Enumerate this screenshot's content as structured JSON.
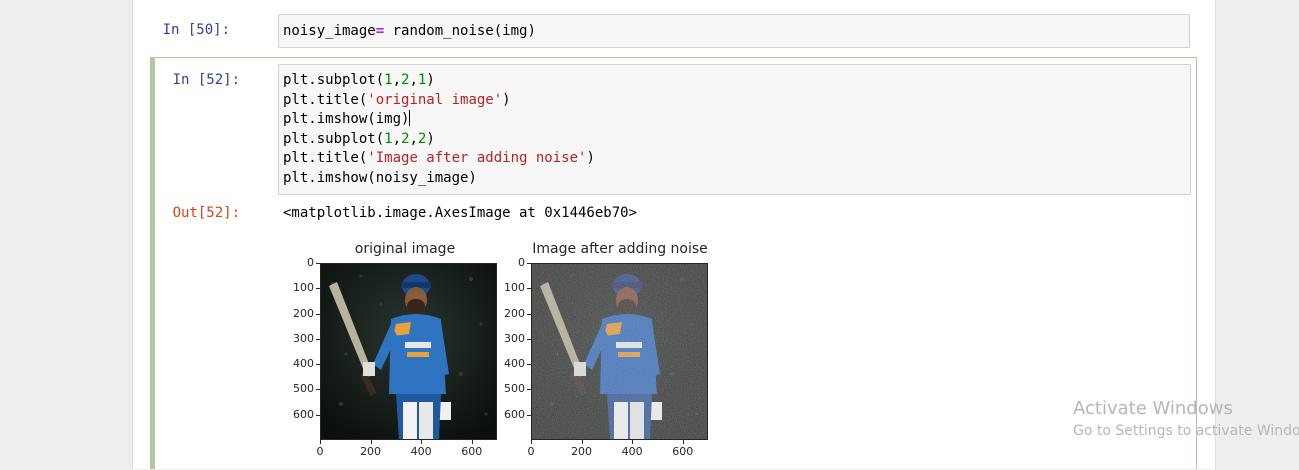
{
  "cells": [
    {
      "prompt": "In [50]:",
      "code_lines": [
        [
          {
            "t": "noisy_image",
            "c": ""
          },
          {
            "t": "=",
            "c": "kw-eq"
          },
          {
            "t": " random_noise(img)",
            "c": ""
          }
        ]
      ]
    },
    {
      "prompt": "In [52]:",
      "code_lines": [
        [
          {
            "t": "plt.subplot(",
            "c": ""
          },
          {
            "t": "1",
            "c": "num"
          },
          {
            "t": ",",
            "c": ""
          },
          {
            "t": "2",
            "c": "num"
          },
          {
            "t": ",",
            "c": ""
          },
          {
            "t": "1",
            "c": "num"
          },
          {
            "t": ")",
            "c": ""
          }
        ],
        [
          {
            "t": "plt.title(",
            "c": ""
          },
          {
            "t": "'original image'",
            "c": "str"
          },
          {
            "t": ")",
            "c": ""
          }
        ],
        [
          {
            "t": "plt.imshow(img)",
            "c": ""
          }
        ],
        [
          {
            "t": "plt.subplot(",
            "c": ""
          },
          {
            "t": "1",
            "c": "num"
          },
          {
            "t": ",",
            "c": ""
          },
          {
            "t": "2",
            "c": "num"
          },
          {
            "t": ",",
            "c": ""
          },
          {
            "t": "2",
            "c": "num"
          },
          {
            "t": ")",
            "c": ""
          }
        ],
        [
          {
            "t": "plt.title(",
            "c": ""
          },
          {
            "t": "'Image after adding noise'",
            "c": "str"
          },
          {
            "t": ")",
            "c": ""
          }
        ],
        [
          {
            "t": "plt.imshow(noisy_image)",
            "c": ""
          }
        ]
      ],
      "out_prompt": "Out[52]:",
      "out_text": "<matplotlib.image.AxesImage at 0x1446eb70>"
    }
  ],
  "chart_data": [
    {
      "type": "image",
      "title": "original image",
      "xticks": [
        "0",
        "200",
        "400",
        "600"
      ],
      "yticks": [
        "0",
        "100",
        "200",
        "300",
        "400",
        "500",
        "600"
      ],
      "xlim": [
        0,
        700
      ],
      "ylim": [
        700,
        0
      ]
    },
    {
      "type": "image",
      "title": "Image after adding noise",
      "xticks": [
        "0",
        "200",
        "400",
        "600"
      ],
      "yticks": [
        "0",
        "100",
        "200",
        "300",
        "400",
        "500",
        "600"
      ],
      "xlim": [
        0,
        700
      ],
      "ylim": [
        700,
        0
      ]
    }
  ],
  "watermark": {
    "line1": "Activate Windows",
    "line2": "Go to Settings to activate Windows"
  },
  "colors": {
    "in_prompt": "#303f9f",
    "out_prompt": "#d84315",
    "selected_cell_border": "#b1c7a2"
  }
}
